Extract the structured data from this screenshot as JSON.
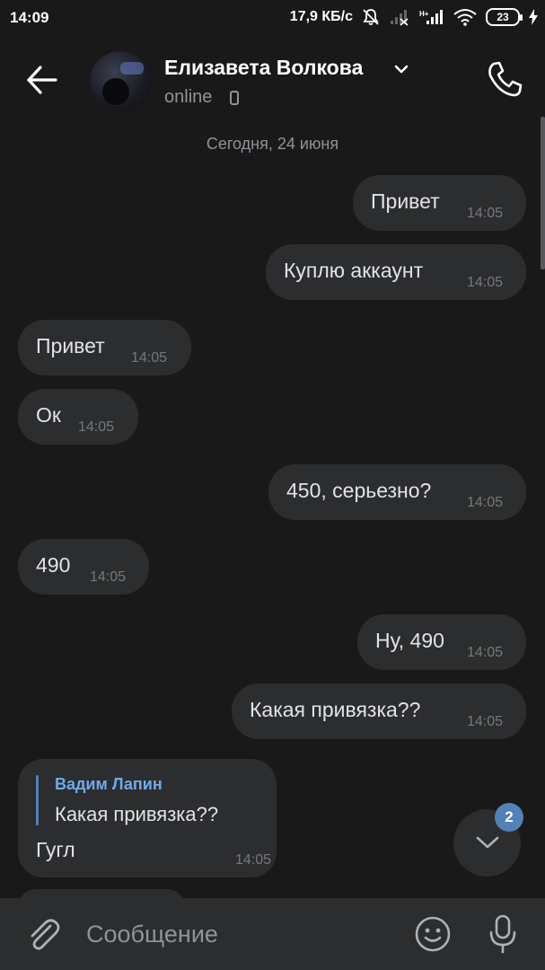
{
  "status_bar": {
    "time": "14:09",
    "network_speed": "17,9 КБ/с",
    "battery": "23"
  },
  "header": {
    "contact_name": "Елизавета Волкова",
    "status": "online"
  },
  "chat": {
    "date_separator": "Сегодня, 24 июня",
    "messages": [
      {
        "side": "out",
        "text": "Привет",
        "time": "14:05"
      },
      {
        "side": "out",
        "text": "Куплю аккаунт",
        "time": "14:05"
      },
      {
        "side": "in",
        "text": "Привет",
        "time": "14:05"
      },
      {
        "side": "in",
        "text": "Ок",
        "time": "14:05"
      },
      {
        "side": "out",
        "text": "450, серьезно?",
        "time": "14:05"
      },
      {
        "side": "in",
        "text": "490",
        "time": "14:05"
      },
      {
        "side": "out",
        "text": "Ну, 490",
        "time": "14:05"
      },
      {
        "side": "out",
        "text": "Какая привязка??",
        "time": "14:05"
      }
    ],
    "reply_message": {
      "quoted_author": "Вадим Лапин",
      "quoted_text": "Какая привязка??",
      "text": "Гугл",
      "time": "14:05"
    },
    "unread_count": "2"
  },
  "composer": {
    "placeholder": "Сообщение"
  },
  "colors": {
    "background": "#19191a",
    "bubble": "#2c2d2e",
    "accent": "#5181b8",
    "reply_author": "#71aaeb"
  }
}
